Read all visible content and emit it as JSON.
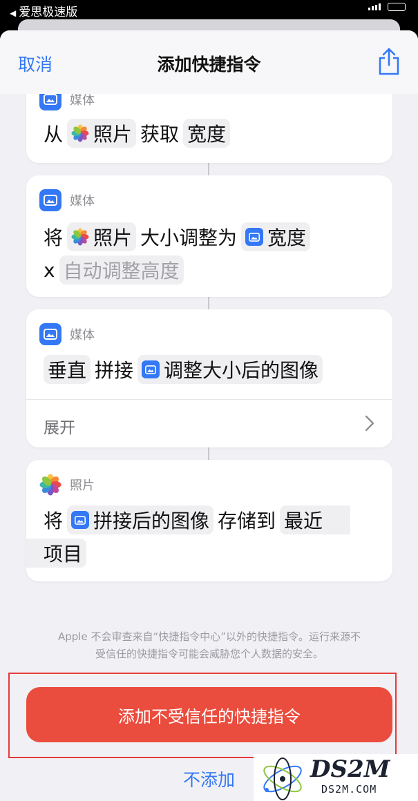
{
  "status_bar": {
    "back_app": "爱思极速版"
  },
  "nav": {
    "cancel": "取消",
    "title": "添加快捷指令"
  },
  "cards": [
    {
      "category": "媒体",
      "line1": {
        "from": "从",
        "photos": "照片",
        "get": "获取",
        "width": "宽度"
      }
    },
    {
      "category": "媒体",
      "line1": {
        "set": "将",
        "photos": "照片",
        "resize_to": "大小调整为",
        "width": "宽度"
      },
      "line2": {
        "x": "x",
        "auto_height": "自动调整高度"
      }
    },
    {
      "category": "媒体",
      "line1": {
        "direction": "垂直",
        "combine": "拼接",
        "resized_images": "调整大小后的图像"
      },
      "expand": "展开"
    },
    {
      "category": "照片",
      "line1": {
        "set": "将",
        "combined_image": "拼接后的图像",
        "save_to": "存储到",
        "recents_a": "最近"
      },
      "line2": {
        "recents_b": "项目"
      }
    }
  ],
  "disclaimer": {
    "line1": "Apple 不会审查来自“快捷指令中心”以外的快捷指令。运行来源不",
    "line2": "受信任的快捷指令可能会威胁您个人数据的安全。"
  },
  "buttons": {
    "add_untrusted": "添加不受信任的快捷指令",
    "dont_add": "不添加"
  },
  "watermark": {
    "logo": "DS2M",
    "domain": "DS2M.COM"
  },
  "colors": {
    "accent_blue": "#3478f6",
    "danger_red": "#ea4c3d",
    "highlight_red": "#e53b3b"
  },
  "icons": [
    "share-icon",
    "media-icon",
    "photos-icon",
    "chevron-right-icon"
  ]
}
